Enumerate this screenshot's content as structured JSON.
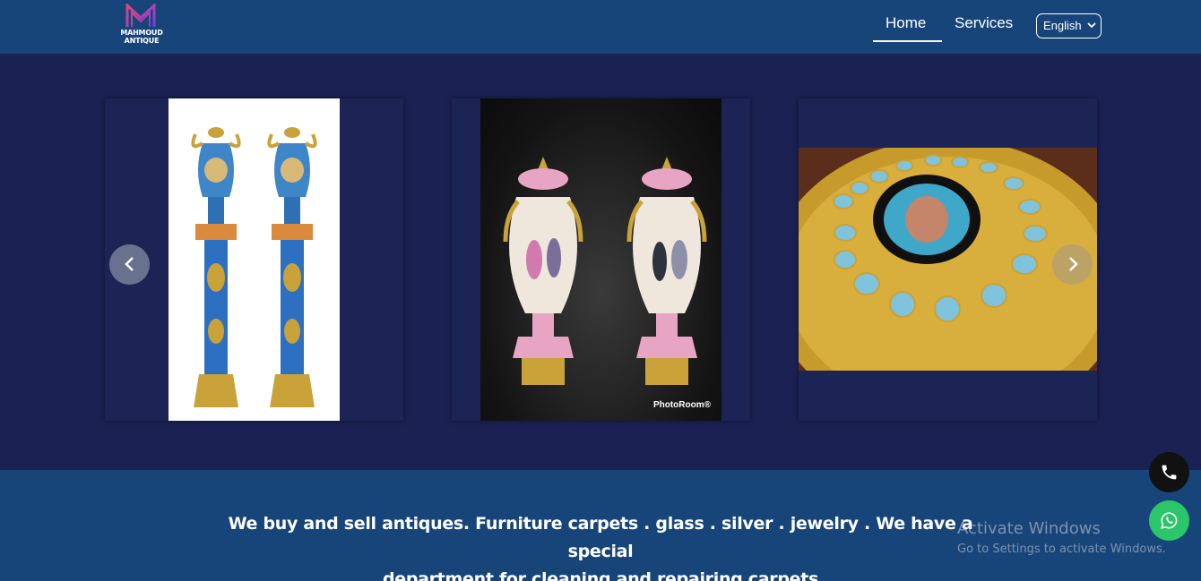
{
  "header": {
    "logo_text_line1": "MAHMOUD",
    "logo_text_line2": "ANTIQUE",
    "nav": [
      {
        "label": "Home",
        "active": true
      },
      {
        "label": "Services",
        "active": false
      }
    ],
    "language": {
      "selected": "English"
    }
  },
  "carousel": {
    "slides": [
      {
        "subject": "pair of blue porcelain vases on pedestals"
      },
      {
        "subject": "pair of painted porcelain urns",
        "watermark": "PhotoRoom®"
      },
      {
        "subject": "gilded table with porcelain plaques"
      }
    ],
    "prev_icon": "chevron-left-icon",
    "next_icon": "chevron-right-icon"
  },
  "about": {
    "line1": "We buy and sell antiques. Furniture carpets . glass . silver . jewelry . We have a special",
    "line2": "department for cleaning and repairing carpets"
  },
  "floating": {
    "phone_icon": "phone-icon",
    "whatsapp_icon": "whatsapp-icon"
  },
  "watermark": {
    "title": "Activate Windows",
    "subtitle": "Go to Settings to activate Windows."
  },
  "colors": {
    "header_bg": "#17457a",
    "page_bg": "#1b2153",
    "whatsapp": "#2bc56a"
  }
}
